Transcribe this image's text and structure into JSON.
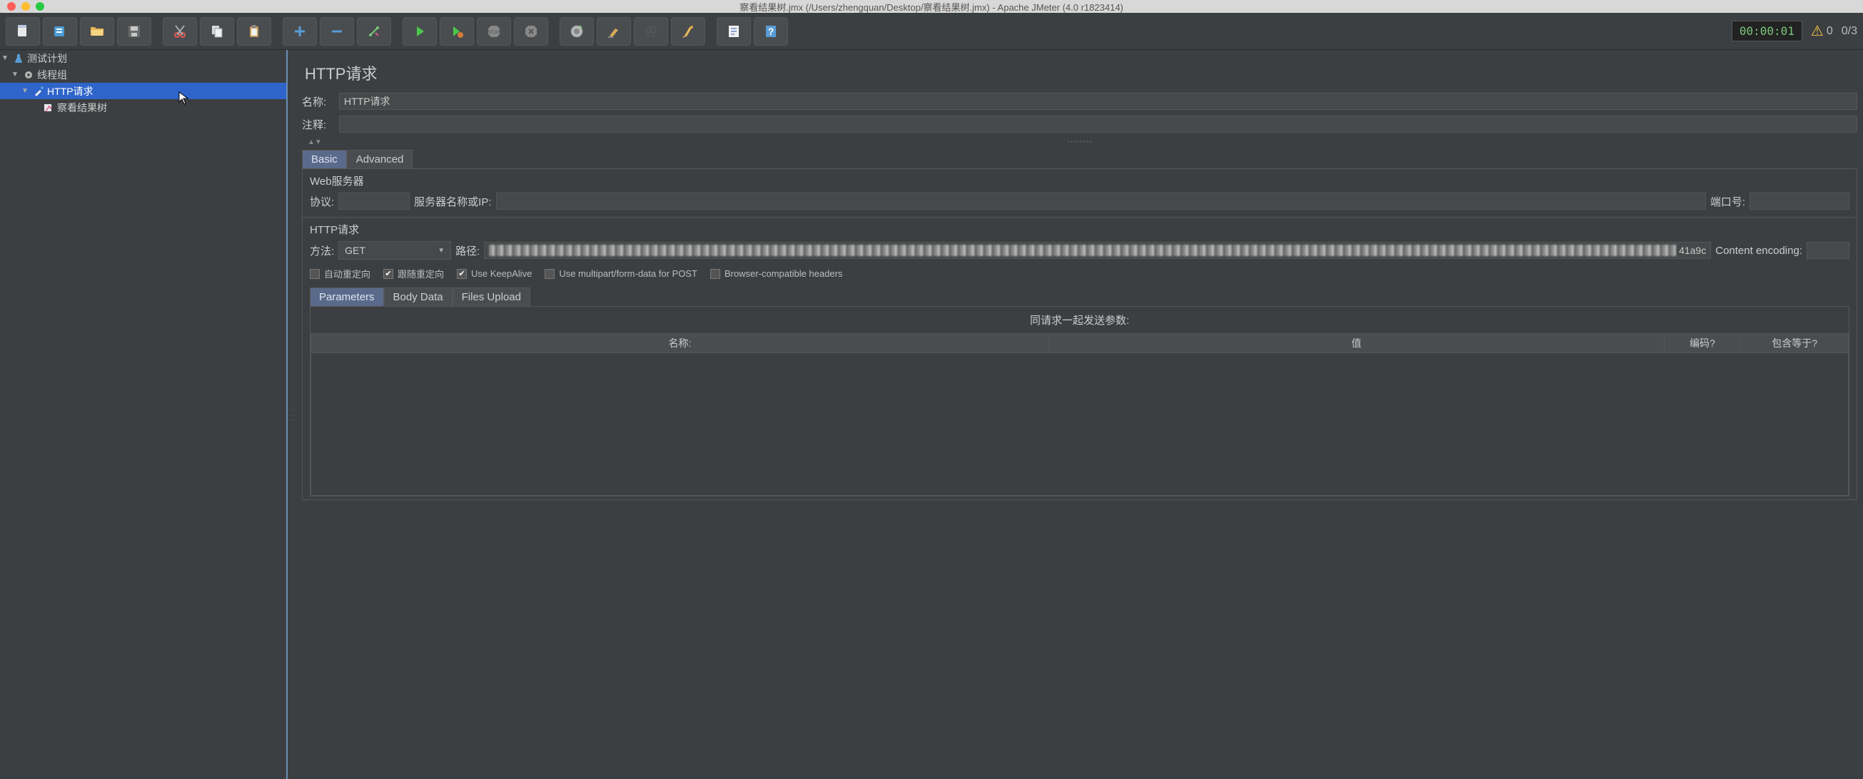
{
  "titlebar": "察看结果树.jmx (/Users/zhengquan/Desktop/察看结果树.jmx) - Apache JMeter (4.0 r1823414)",
  "toolbar": {
    "timer": "00:00:01",
    "warn_count": "0",
    "ratio": "0/3"
  },
  "tree": {
    "root": "测试计划",
    "thread_group": "线程组",
    "http_request": "HTTP请求",
    "results_tree": "察看结果树"
  },
  "panel": {
    "title": "HTTP请求",
    "name_label": "名称:",
    "name_value": "HTTP请求",
    "comment_label": "注释:",
    "comment_value": "",
    "tabs": {
      "basic": "Basic",
      "advanced": "Advanced"
    },
    "web_server_title": "Web服务器",
    "protocol_label": "协议:",
    "protocol_value": "",
    "server_label": "服务器名称或IP:",
    "server_value": "",
    "port_label": "端口号:",
    "port_value": "",
    "http_req_title": "HTTP请求",
    "method_label": "方法:",
    "method_value": "GET",
    "path_label": "路径:",
    "path_suffix": "41a9c",
    "encoding_label": "Content encoding:",
    "encoding_value": "",
    "checks": {
      "auto_redirect": "自动重定向",
      "follow_redirect": "跟随重定向",
      "keepalive": "Use KeepAlive",
      "multipart": "Use multipart/form-data for POST",
      "browser_compat": "Browser-compatible headers"
    },
    "subtabs": {
      "parameters": "Parameters",
      "body": "Body Data",
      "files": "Files Upload"
    },
    "params_header": "同请求一起发送参数:",
    "table_headers": {
      "name": "名称:",
      "value": "值",
      "encode": "编码?",
      "include_equals": "包含等于?"
    }
  }
}
